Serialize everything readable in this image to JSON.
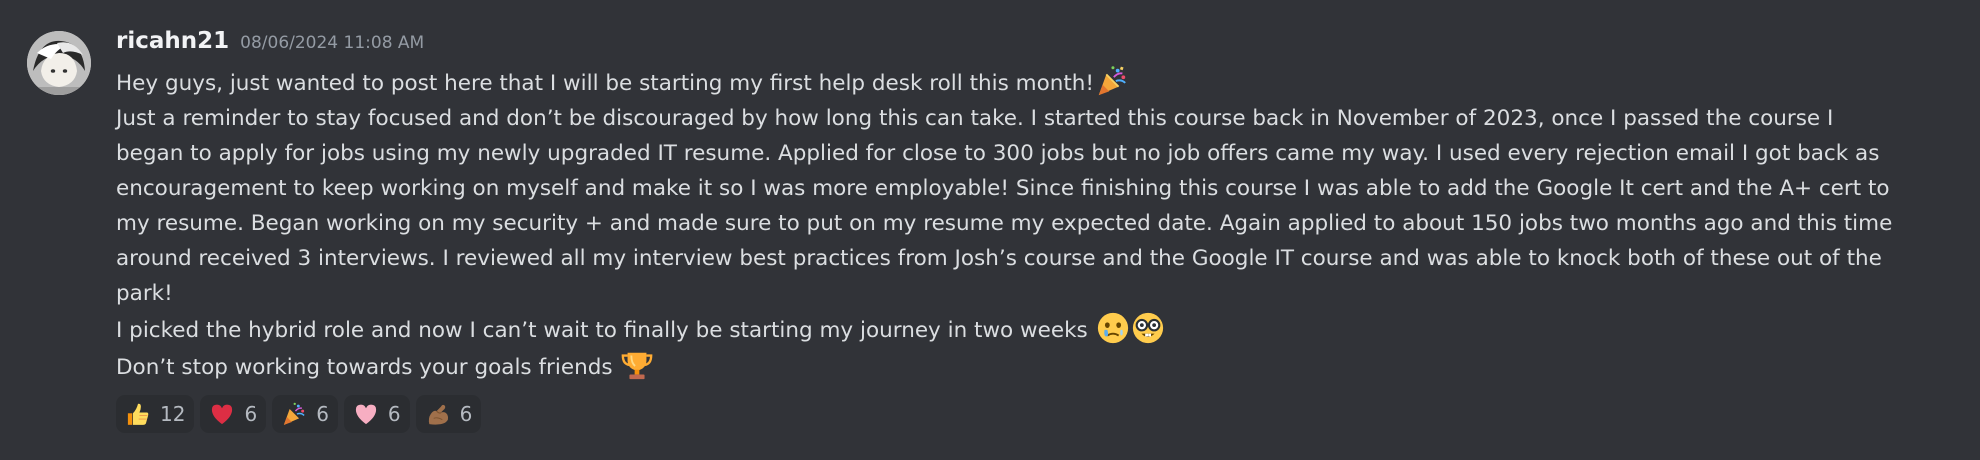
{
  "message": {
    "author": "ricahn21",
    "timestamp": "08/06/2024 11:08 AM",
    "lines": [
      "Hey guys, just wanted to post here that I will be starting my first help desk roll this month!",
      "Just a reminder to stay focused and don’t be discouraged by how long this can take. I started this course back in November of 2023, once I passed the course I",
      "began to apply for jobs using my newly upgraded IT resume. Applied for close to 300 jobs but no job offers came my way. I used every rejection email I got back as",
      "encouragement to keep working on myself and make it so I was more employable! Since finishing this course I was able to add the Google It cert and the A+ cert to",
      "my resume. Began working on my security + and made sure to put on my resume my expected date. Again applied to about 150 jobs two months ago and this time",
      "around received 3 interviews. I reviewed all my interview best practices from Josh’s course and the Google IT course and was able to knock both of these out of the",
      "park!",
      "I picked the hybrid role and now I can’t wait to finally be starting my journey in two weeks",
      "Don’t stop working towards your goals friends"
    ],
    "inline_emojis": {
      "line1": [
        "party-popper-emoji"
      ],
      "line8": [
        "holding-back-tears-emoji",
        "nerd-face-emoji"
      ],
      "line9": [
        "trophy-emoji"
      ]
    }
  },
  "reactions": [
    {
      "emoji": "thumbs-up-emoji",
      "count": "12"
    },
    {
      "emoji": "red-heart-emoji",
      "count": "6"
    },
    {
      "emoji": "party-popper-emoji",
      "count": "6"
    },
    {
      "emoji": "pink-heart-emoji",
      "count": "6"
    },
    {
      "emoji": "flexed-biceps-emoji",
      "count": "6"
    }
  ],
  "colors": {
    "background": "#313338",
    "username": "#f2f3f5",
    "timestamp": "#949ba4",
    "text": "#dbdee1",
    "reaction_bg": "#2b2d31",
    "reaction_count": "#b5bac1"
  }
}
